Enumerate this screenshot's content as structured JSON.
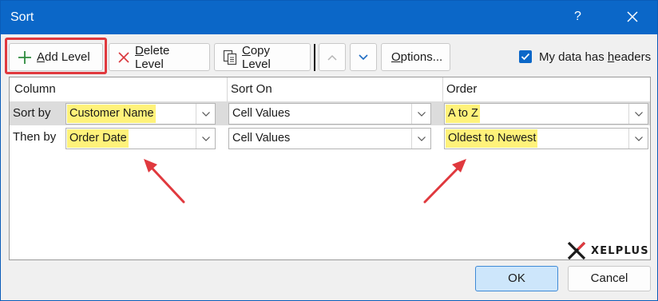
{
  "window": {
    "title": "Sort",
    "help_glyph": "?"
  },
  "toolbar": {
    "add_level": {
      "accel": "A",
      "rest": "dd Level"
    },
    "delete_level": {
      "accel": "D",
      "rest": "elete Level"
    },
    "copy_level": {
      "accel": "C",
      "rest": "opy Level"
    },
    "options": {
      "accel": "O",
      "rest": "ptions..."
    },
    "my_data_headers": {
      "prefix": "My data has ",
      "accel": "h",
      "suffix": "eaders",
      "checked": true
    }
  },
  "grid": {
    "headers": {
      "column": "Column",
      "sort_on": "Sort On",
      "order": "Order"
    },
    "rows": [
      {
        "label": "Sort by",
        "column": "Customer Name",
        "sort_on": "Cell Values",
        "order": "A to Z",
        "selected": true
      },
      {
        "label": "Then by",
        "column": "Order Date",
        "sort_on": "Cell Values",
        "order": "Oldest to Newest",
        "selected": false
      }
    ]
  },
  "logo": {
    "text": "XELPLUS"
  },
  "footer": {
    "ok": "OK",
    "cancel": "Cancel"
  },
  "colors": {
    "title_bar": "#0b67c8",
    "highlight": "#fff27a",
    "annotation_red": "#e0393e",
    "ok_fill": "#cde6fb"
  }
}
